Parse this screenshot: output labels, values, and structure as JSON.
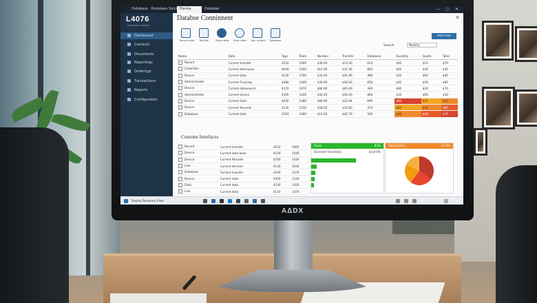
{
  "monitor": {
    "brand": "AΔDX"
  },
  "topbar": {
    "left_text": "Database · Database Secretariat",
    "tab_label": "Planka",
    "tab2_label": "Databae"
  },
  "sidebar": {
    "logo": "L4076",
    "logo_sub": "Database systems",
    "items": [
      {
        "label": "Dashboard"
      },
      {
        "label": "Contacts"
      },
      {
        "label": "Documents"
      },
      {
        "label": "Reportings"
      },
      {
        "label": "Orderings"
      },
      {
        "label": "Transactions"
      },
      {
        "label": "Reports"
      },
      {
        "label": "Configuration"
      }
    ]
  },
  "main": {
    "title": "Databse Conninnent",
    "toolbar": [
      {
        "label": "Record data"
      },
      {
        "label": "Test file"
      },
      {
        "label": "Share data"
      },
      {
        "label": "Alias notes"
      },
      {
        "label": "Key content"
      },
      {
        "label": "Database"
      }
    ],
    "filter_label": "Search",
    "filter_value": "Monthly",
    "primary_button": "Add new",
    "top_table": {
      "headers": [
        "Name",
        "Data",
        "Tags",
        "Team",
        "Number",
        "Transfer",
        "Database",
        "Quantity",
        "Quota",
        "Total"
      ],
      "rows": [
        [
          "Record",
          "Current transfer",
          "4510",
          "1000",
          "$30.00",
          "$12.00",
          "610",
          "$40",
          "$10",
          "$70"
        ],
        [
          "Collection",
          "Current data base",
          "4040",
          "1400",
          "$14.90",
          "$31.40",
          "840",
          "$60",
          "$30",
          "$30"
        ],
        [
          "Device",
          "Current data",
          "4130",
          "1700",
          "$34.00",
          "$41.90",
          "480",
          "$30",
          "$60",
          "$40"
        ],
        [
          "Administrator",
          "Current Tracking",
          "4480",
          "1040",
          "$30.90",
          "$36.00",
          "650",
          "$40",
          "$30",
          "$60"
        ],
        [
          "Device",
          "Current datasource",
          "4370",
          "1070",
          "$84.00",
          "$65.06",
          "440",
          "$90",
          "$30",
          "$70"
        ],
        [
          "Administrator",
          "Current device",
          "4300",
          "1040",
          "$32.40",
          "$40.00",
          "860",
          "$10",
          "$60",
          "$30"
        ],
        [
          "Device",
          "Current data",
          "4030",
          "1380",
          "$66.90",
          "$32.94",
          "690",
          "$60",
          "$40",
          "$10"
        ],
        [
          "Device",
          "Current Records",
          "4130",
          "1130",
          "$58.50",
          "$14.60",
          "370",
          "$80",
          "$30",
          "$80"
        ],
        [
          "Database",
          "Current data",
          "4310",
          "1480",
          "$12.00",
          "$42.70",
          "500",
          "$40",
          "$30",
          "$70"
        ]
      ],
      "highlighted_rows": [
        6,
        7,
        8
      ]
    },
    "section_title": "Custome Interfaces",
    "bottom_table": {
      "rows": [
        [
          "Record",
          "Current transfer",
          "4510",
          "1000"
        ],
        [
          "Device",
          "Current data base",
          "4140",
          "1040"
        ],
        [
          "Device",
          "Current Records",
          "4350",
          "1430"
        ],
        [
          "Link",
          "Current devices",
          "4130",
          "1030"
        ],
        [
          "Database",
          "Current transfer",
          "4430",
          "1470"
        ],
        [
          "Device",
          "Current data",
          "4300",
          "1120"
        ],
        [
          "Data",
          "Current data",
          "4330",
          "1450"
        ],
        [
          "Link",
          "Current data",
          "4110",
          "1470"
        ]
      ]
    },
    "green_panel": {
      "header": "Paolo",
      "header_right": "83%",
      "subheader": "Diamond Secretary",
      "subheader_right": "$3.8 0%",
      "bar_fractions": [
        0.62,
        0.08,
        0.06,
        0.05,
        0.04
      ]
    },
    "pie_panel": {
      "header": "Total Orders",
      "header_right": "$3.8%",
      "chart_data": {
        "type": "pie",
        "values": [
          35,
          25,
          22,
          18
        ],
        "colors": [
          "#c0392b",
          "#e8452c",
          "#f39c12",
          "#f5b041"
        ]
      }
    }
  },
  "taskbar": {
    "status_text": "Deploy Recovery View"
  },
  "colors": {
    "sidebar": "#1f3348",
    "accent": "#2e6ea6",
    "green": "#2bb52b",
    "orange": "#f08a2c"
  }
}
